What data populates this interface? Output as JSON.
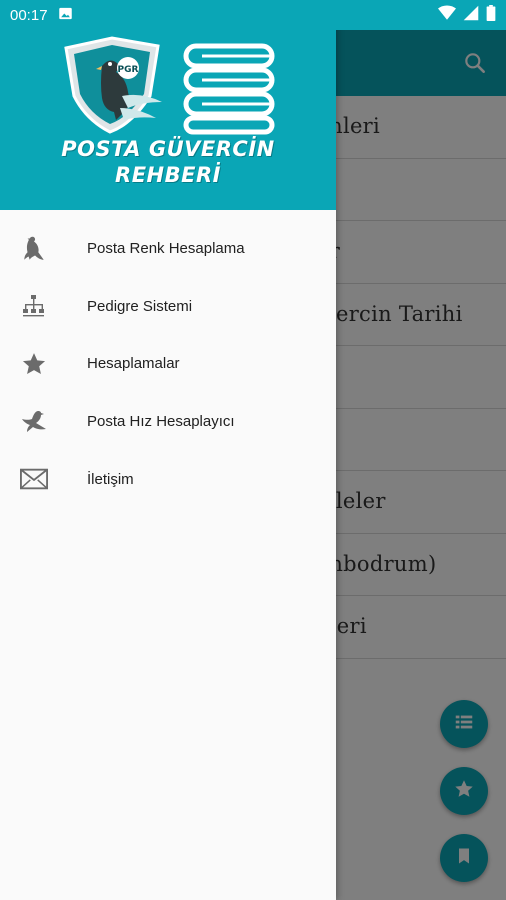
{
  "status_bar": {
    "time": "00:17",
    "icons": [
      "image-icon",
      "wifi-icon",
      "signal-icon",
      "battery-icon"
    ]
  },
  "drawer": {
    "header": {
      "badge": "PGR",
      "title_line1": "POSTA GÜVERCİN",
      "title_line2": "REHBERİ"
    },
    "items": [
      {
        "label": "Posta Renk Hesaplama",
        "icon": "pigeon-icon"
      },
      {
        "label": "Pedigre Sistemi",
        "icon": "pedigree-tree-icon"
      },
      {
        "label": "Hesaplamalar",
        "icon": "star-icon"
      },
      {
        "label": "Posta Hız Hesaplayıcı",
        "icon": "flying-pigeon-icon"
      },
      {
        "label": "İletişim",
        "icon": "mail-icon"
      }
    ]
  },
  "background": {
    "list_items": [
      "emleri",
      "",
      "ler",
      "üvercin Tarihi",
      "er",
      "r",
      "kaleler",
      "ombodrum)",
      "leleri"
    ],
    "fabs": [
      "list-icon",
      "star-icon",
      "bookmark-icon"
    ]
  },
  "colors": {
    "primary": "#0aa6b6",
    "drawer_bg": "#fafafa",
    "icon_gray": "#6b6b6b"
  }
}
